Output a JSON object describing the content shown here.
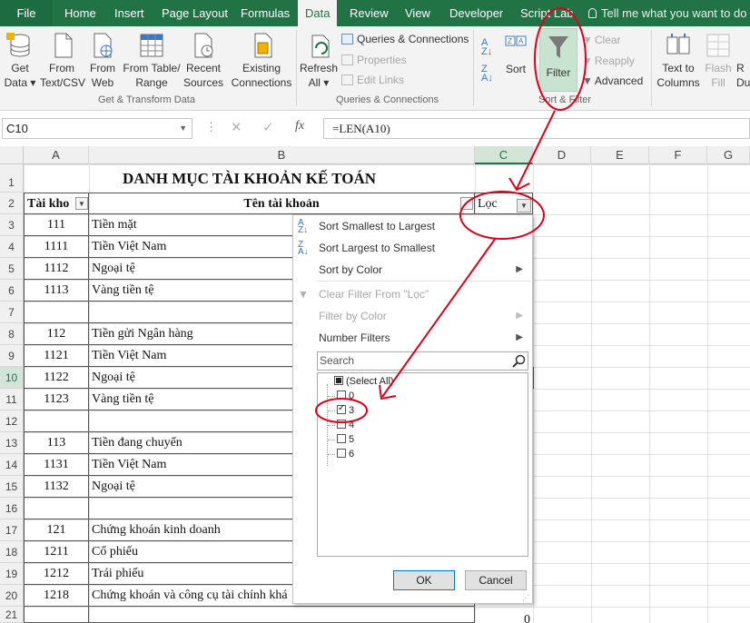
{
  "tabs": [
    "File",
    "Home",
    "Insert",
    "Page Layout",
    "Formulas",
    "Data",
    "Review",
    "View",
    "Developer",
    "Script Lab"
  ],
  "tell_me": "Tell me what you want to do",
  "ribbon": {
    "get_data": [
      "Get",
      "Data ▾"
    ],
    "from_text": [
      "From",
      "Text/CSV"
    ],
    "from_web": [
      "From",
      "Web"
    ],
    "from_table": [
      "From Table/",
      "Range"
    ],
    "recent_sources": [
      "Recent",
      "Sources"
    ],
    "existing_connections": [
      "Existing",
      "Connections"
    ],
    "group_get_transform": "Get & Transform Data",
    "refresh_all": [
      "Refresh",
      "All ▾"
    ],
    "queries_connections": "Queries & Connections",
    "properties": "Properties",
    "edit_links": "Edit Links",
    "group_queries": "Queries & Connections",
    "sort": "Sort",
    "filter": "Filter",
    "clear": "Clear",
    "reapply": "Reapply",
    "advanced": "Advanced",
    "group_sort_filter": "Sort & Filter",
    "text_to_columns": [
      "Text to",
      "Columns"
    ],
    "flash_fill": [
      "Flash",
      "Fill"
    ],
    "remove_dup_partial": [
      "R",
      "Du"
    ]
  },
  "formula_bar": {
    "name_box": "C10",
    "fx": "fx",
    "formula": "=LEN(A10)"
  },
  "columns": [
    "A",
    "B",
    "C",
    "D",
    "E",
    "F",
    "G"
  ],
  "rows": [
    "1",
    "2",
    "3",
    "4",
    "5",
    "6",
    "7",
    "8",
    "9",
    "10",
    "11",
    "12",
    "13",
    "14",
    "15",
    "16",
    "17",
    "18",
    "19",
    "20",
    "21"
  ],
  "sheet": {
    "title": "DANH MỤC TÀI KHOẢN KẾ TOÁN",
    "header_a": "Tài kho",
    "header_b": "Tên tài khoản",
    "header_c": "Lọc",
    "data": [
      [
        "111",
        "Tiền mặt"
      ],
      [
        "1111",
        "Tiền Việt Nam"
      ],
      [
        "1112",
        "Ngoại tệ"
      ],
      [
        "1113",
        "Vàng tiền tệ"
      ],
      [
        "",
        ""
      ],
      [
        "112",
        "Tiền gửi Ngân hàng"
      ],
      [
        "1121",
        "Tiền Việt Nam"
      ],
      [
        "1122",
        "Ngoại tệ"
      ],
      [
        "1123",
        "Vàng tiền tệ"
      ],
      [
        "",
        ""
      ],
      [
        "113",
        "Tiền đang chuyển"
      ],
      [
        "1131",
        "Tiền Việt Nam"
      ],
      [
        "1132",
        "Ngoại tệ"
      ],
      [
        "",
        ""
      ],
      [
        "121",
        "Chứng khoán kinh doanh"
      ],
      [
        "1211",
        "Cổ phiếu"
      ],
      [
        "1212",
        "Trái phiếu"
      ],
      [
        "1218",
        "Chứng khoán và công cụ tài chính khá"
      ],
      [
        "",
        ""
      ]
    ],
    "c21_value": "0"
  },
  "filter_menu": {
    "sort_asc": "Sort Smallest to Largest",
    "sort_desc": "Sort Largest to Smallest",
    "sort_color": "Sort by Color",
    "clear_filter": "Clear Filter From \"Lọc\"",
    "filter_color": "Filter by Color",
    "number_filters": "Number Filters",
    "search_placeholder": "Search",
    "items": [
      {
        "label": "(Select All)",
        "state": "partial"
      },
      {
        "label": "0",
        "state": "unchecked"
      },
      {
        "label": "3",
        "state": "checked"
      },
      {
        "label": "4",
        "state": "unchecked"
      },
      {
        "label": "5",
        "state": "unchecked"
      },
      {
        "label": "6",
        "state": "unchecked"
      }
    ],
    "ok": "OK",
    "cancel": "Cancel"
  },
  "colors": {
    "excel_green": "#217346",
    "annotation_red": "#e0001b"
  }
}
